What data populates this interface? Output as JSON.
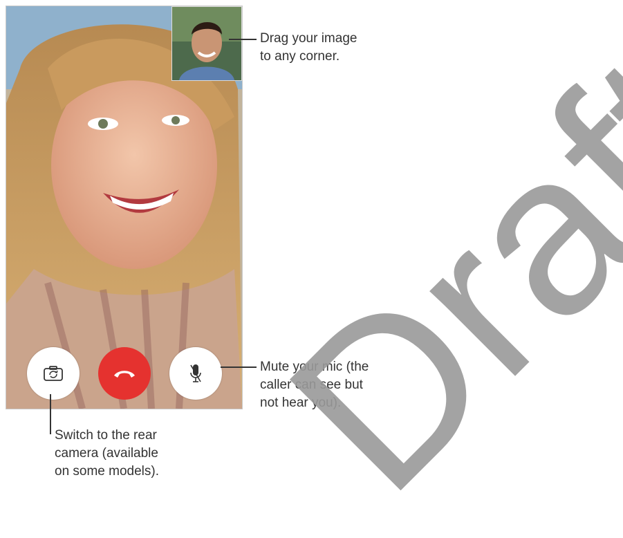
{
  "callouts": {
    "drag_image": "Drag your image\nto any corner.",
    "mute_mic": "Mute your mic (the\ncaller can see but\nnot hear you).",
    "switch_camera": "Switch to the rear\ncamera (available\non some models)."
  },
  "controls": [
    {
      "name": "flip-camera-button",
      "icon": "camera-flip-icon"
    },
    {
      "name": "end-call-button",
      "icon": "phone-hangup-icon"
    },
    {
      "name": "mute-button",
      "icon": "mic-mute-icon"
    }
  ],
  "watermark": "Draft",
  "colors": {
    "end_call_red": "#e5322f",
    "control_white": "#ffffff"
  }
}
